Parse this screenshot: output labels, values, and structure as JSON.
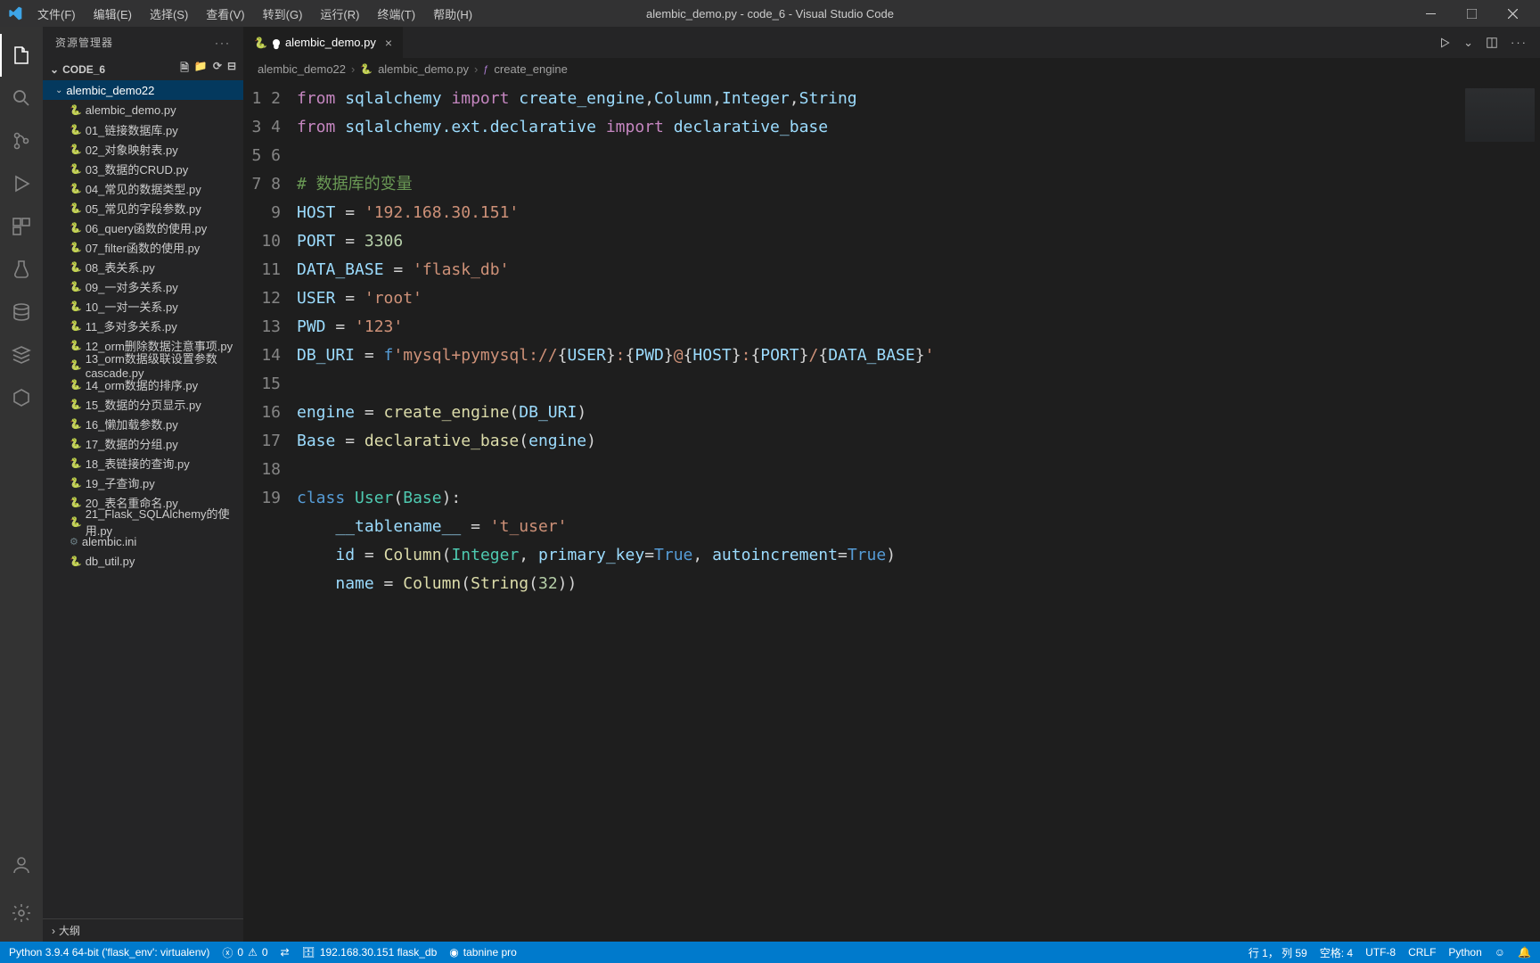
{
  "window": {
    "title": "alembic_demo.py - code_6 - Visual Studio Code"
  },
  "menu": {
    "items": [
      "文件(F)",
      "编辑(E)",
      "选择(S)",
      "查看(V)",
      "转到(G)",
      "运行(R)",
      "终端(T)",
      "帮助(H)"
    ]
  },
  "sidebar": {
    "title": "资源管理器",
    "project": "CODE_6",
    "folder": "alembic_demo22",
    "files": [
      "alembic_demo.py",
      "01_链接数据库.py",
      "02_对象映射表.py",
      "03_数据的CRUD.py",
      "04_常见的数据类型.py",
      "05_常见的字段参数.py",
      "06_query函数的使用.py",
      "07_filter函数的使用.py",
      "08_表关系.py",
      "09_一对多关系.py",
      "10_一对一关系.py",
      "11_多对多关系.py",
      "12_orm删除数据注意事项.py",
      "13_orm数据级联设置参数cascade.py",
      "14_orm数据的排序.py",
      "15_数据的分页显示.py",
      "16_懒加载参数.py",
      "17_数据的分组.py",
      "18_表链接的查询.py",
      "19_子查询.py",
      "20_表名重命名.py",
      "21_Flask_SQLAlchemy的使用.py",
      "alembic.ini",
      "db_util.py"
    ],
    "outline": "大纲"
  },
  "tab": {
    "filename": "alembic_demo.py",
    "modified": true
  },
  "breadcrumbs": {
    "items": [
      "alembic_demo22",
      "alembic_demo.py",
      "create_engine"
    ]
  },
  "editor": {
    "line_count": 19
  },
  "statusbar": {
    "python": "Python 3.9.4 64-bit ('flask_env': virtualenv)",
    "errors": "0",
    "warnings": "0",
    "port_icon": "⇄",
    "db": "192.168.30.151  flask_db",
    "tabnine": "tabnine pro",
    "cursor": "行 1， 列 59",
    "spaces": "空格: 4",
    "encoding": "UTF-8",
    "eol": "CRLF",
    "lang": "Python"
  }
}
